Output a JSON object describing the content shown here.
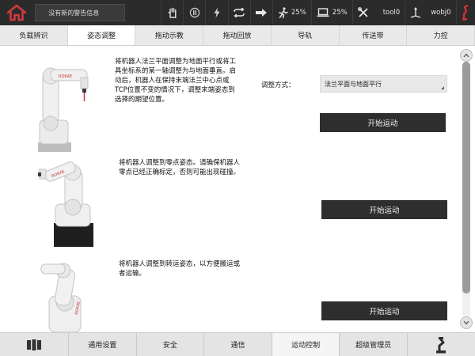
{
  "colors": {
    "accent": "#c8343a",
    "topbar": "#2b2b2b",
    "button": "#2e2e2e"
  },
  "topbar": {
    "warning_text": "没有新的警告信息",
    "icons": [
      "home-icon",
      "hand-icon",
      "record-icon",
      "lightning-icon",
      "loop-icon",
      "step-arrow-icon",
      "jog-speed-icon",
      "speed-icon",
      "tool-icon",
      "wobj-icon",
      "robot-arm-icon"
    ],
    "jog_speed": "25%",
    "speed": "25%",
    "tool": "tool0",
    "wobj": "wobj0"
  },
  "tabs": [
    {
      "label": "负载辨识",
      "active": false
    },
    {
      "label": "姿态调整",
      "active": true
    },
    {
      "label": "拖动示教",
      "active": false
    },
    {
      "label": "拖动回放",
      "active": false
    },
    {
      "label": "导轨",
      "active": false
    },
    {
      "label": "传送带",
      "active": false
    },
    {
      "label": "力控",
      "active": false
    }
  ],
  "main": {
    "section1": {
      "description": [
        "将机器人法兰平面调整为地面平行或将工",
        "具坐标系的某一轴调整为与地面垂直。启",
        "动后，机器人在保持末端法兰中心点或",
        "TCP位置不变的情况下，调整末端姿态到",
        "选择的期望位置。"
      ],
      "mode_label": "调整方式：",
      "mode_value": "法兰平面与地面平行",
      "button": "开始运动"
    },
    "section2": {
      "description": [
        "将机器人调整到零点姿态。请确保机器人",
        "零点已经正确标定，否则可能出现碰撞。"
      ],
      "button": "开始运动"
    },
    "section3": {
      "description": [
        "将机器人调整到转运姿态，以方便搬运或",
        "者运输。"
      ],
      "button": "开始运动"
    }
  },
  "bottombar": {
    "items": [
      {
        "label": "通用设置",
        "active": false
      },
      {
        "label": "安全",
        "active": false
      },
      {
        "label": "通信",
        "active": false
      },
      {
        "label": "运动控制",
        "active": true
      },
      {
        "label": "超级管理员",
        "active": false
      }
    ],
    "left_icon": "panel-icon",
    "right_icon": "robot-arm-icon"
  }
}
